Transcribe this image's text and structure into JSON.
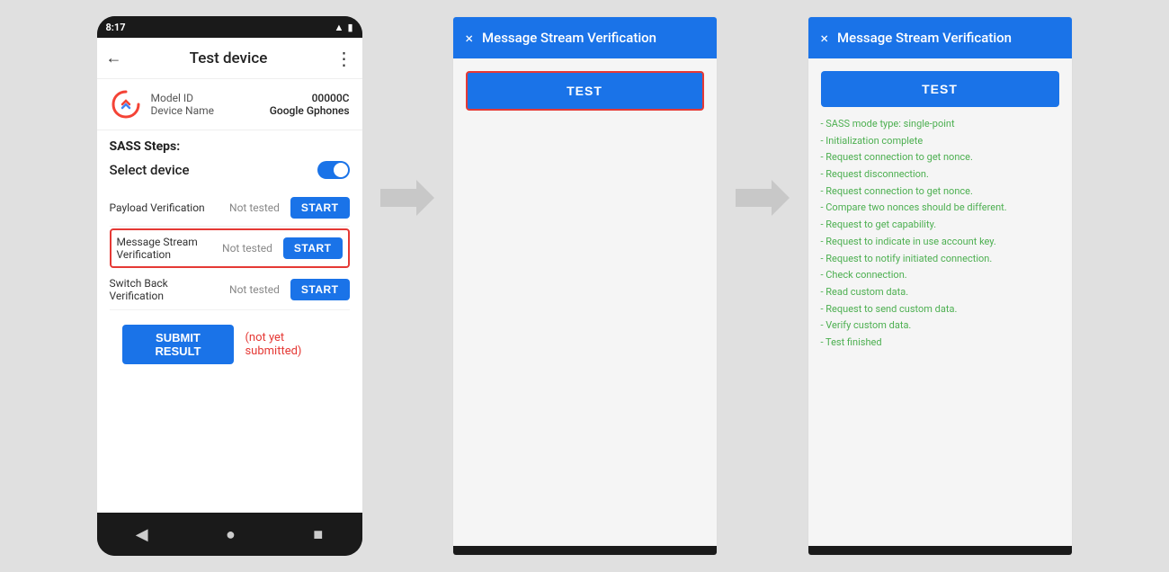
{
  "phone": {
    "status_time": "8:17",
    "title": "Test device",
    "model_label": "Model ID",
    "model_value": "00000C",
    "device_label": "Device Name",
    "device_value": "Google Gphones",
    "sass_title": "SASS Steps:",
    "select_device_label": "Select device",
    "rows": [
      {
        "label": "Payload Verification",
        "status": "Not tested",
        "btn": "START"
      },
      {
        "label": "Message Stream Verification",
        "status": "Not tested",
        "btn": "START",
        "highlighted": true
      },
      {
        "label": "Switch Back Verification",
        "status": "Not tested",
        "btn": "START"
      }
    ],
    "submit_btn": "SUBMIT RESULT",
    "not_submitted": "(not yet submitted)"
  },
  "dialog1": {
    "close_icon": "×",
    "title": "Message Stream Verification",
    "test_btn": "TEST"
  },
  "dialog2": {
    "close_icon": "×",
    "title": "Message Stream Verification",
    "test_btn": "TEST",
    "log": [
      "- SASS mode type: single-point",
      "- Initialization complete",
      "- Request connection to get nonce.",
      "- Request disconnection.",
      "- Request connection to get nonce.",
      "- Compare two nonces should be different.",
      "- Request to get capability.",
      "- Request to indicate in use account key.",
      "- Request to notify initiated connection.",
      "- Check connection.",
      "- Read custom data.",
      "- Request to send custom data.",
      "- Verify custom data.",
      "- Test finished"
    ]
  },
  "arrow": "→"
}
